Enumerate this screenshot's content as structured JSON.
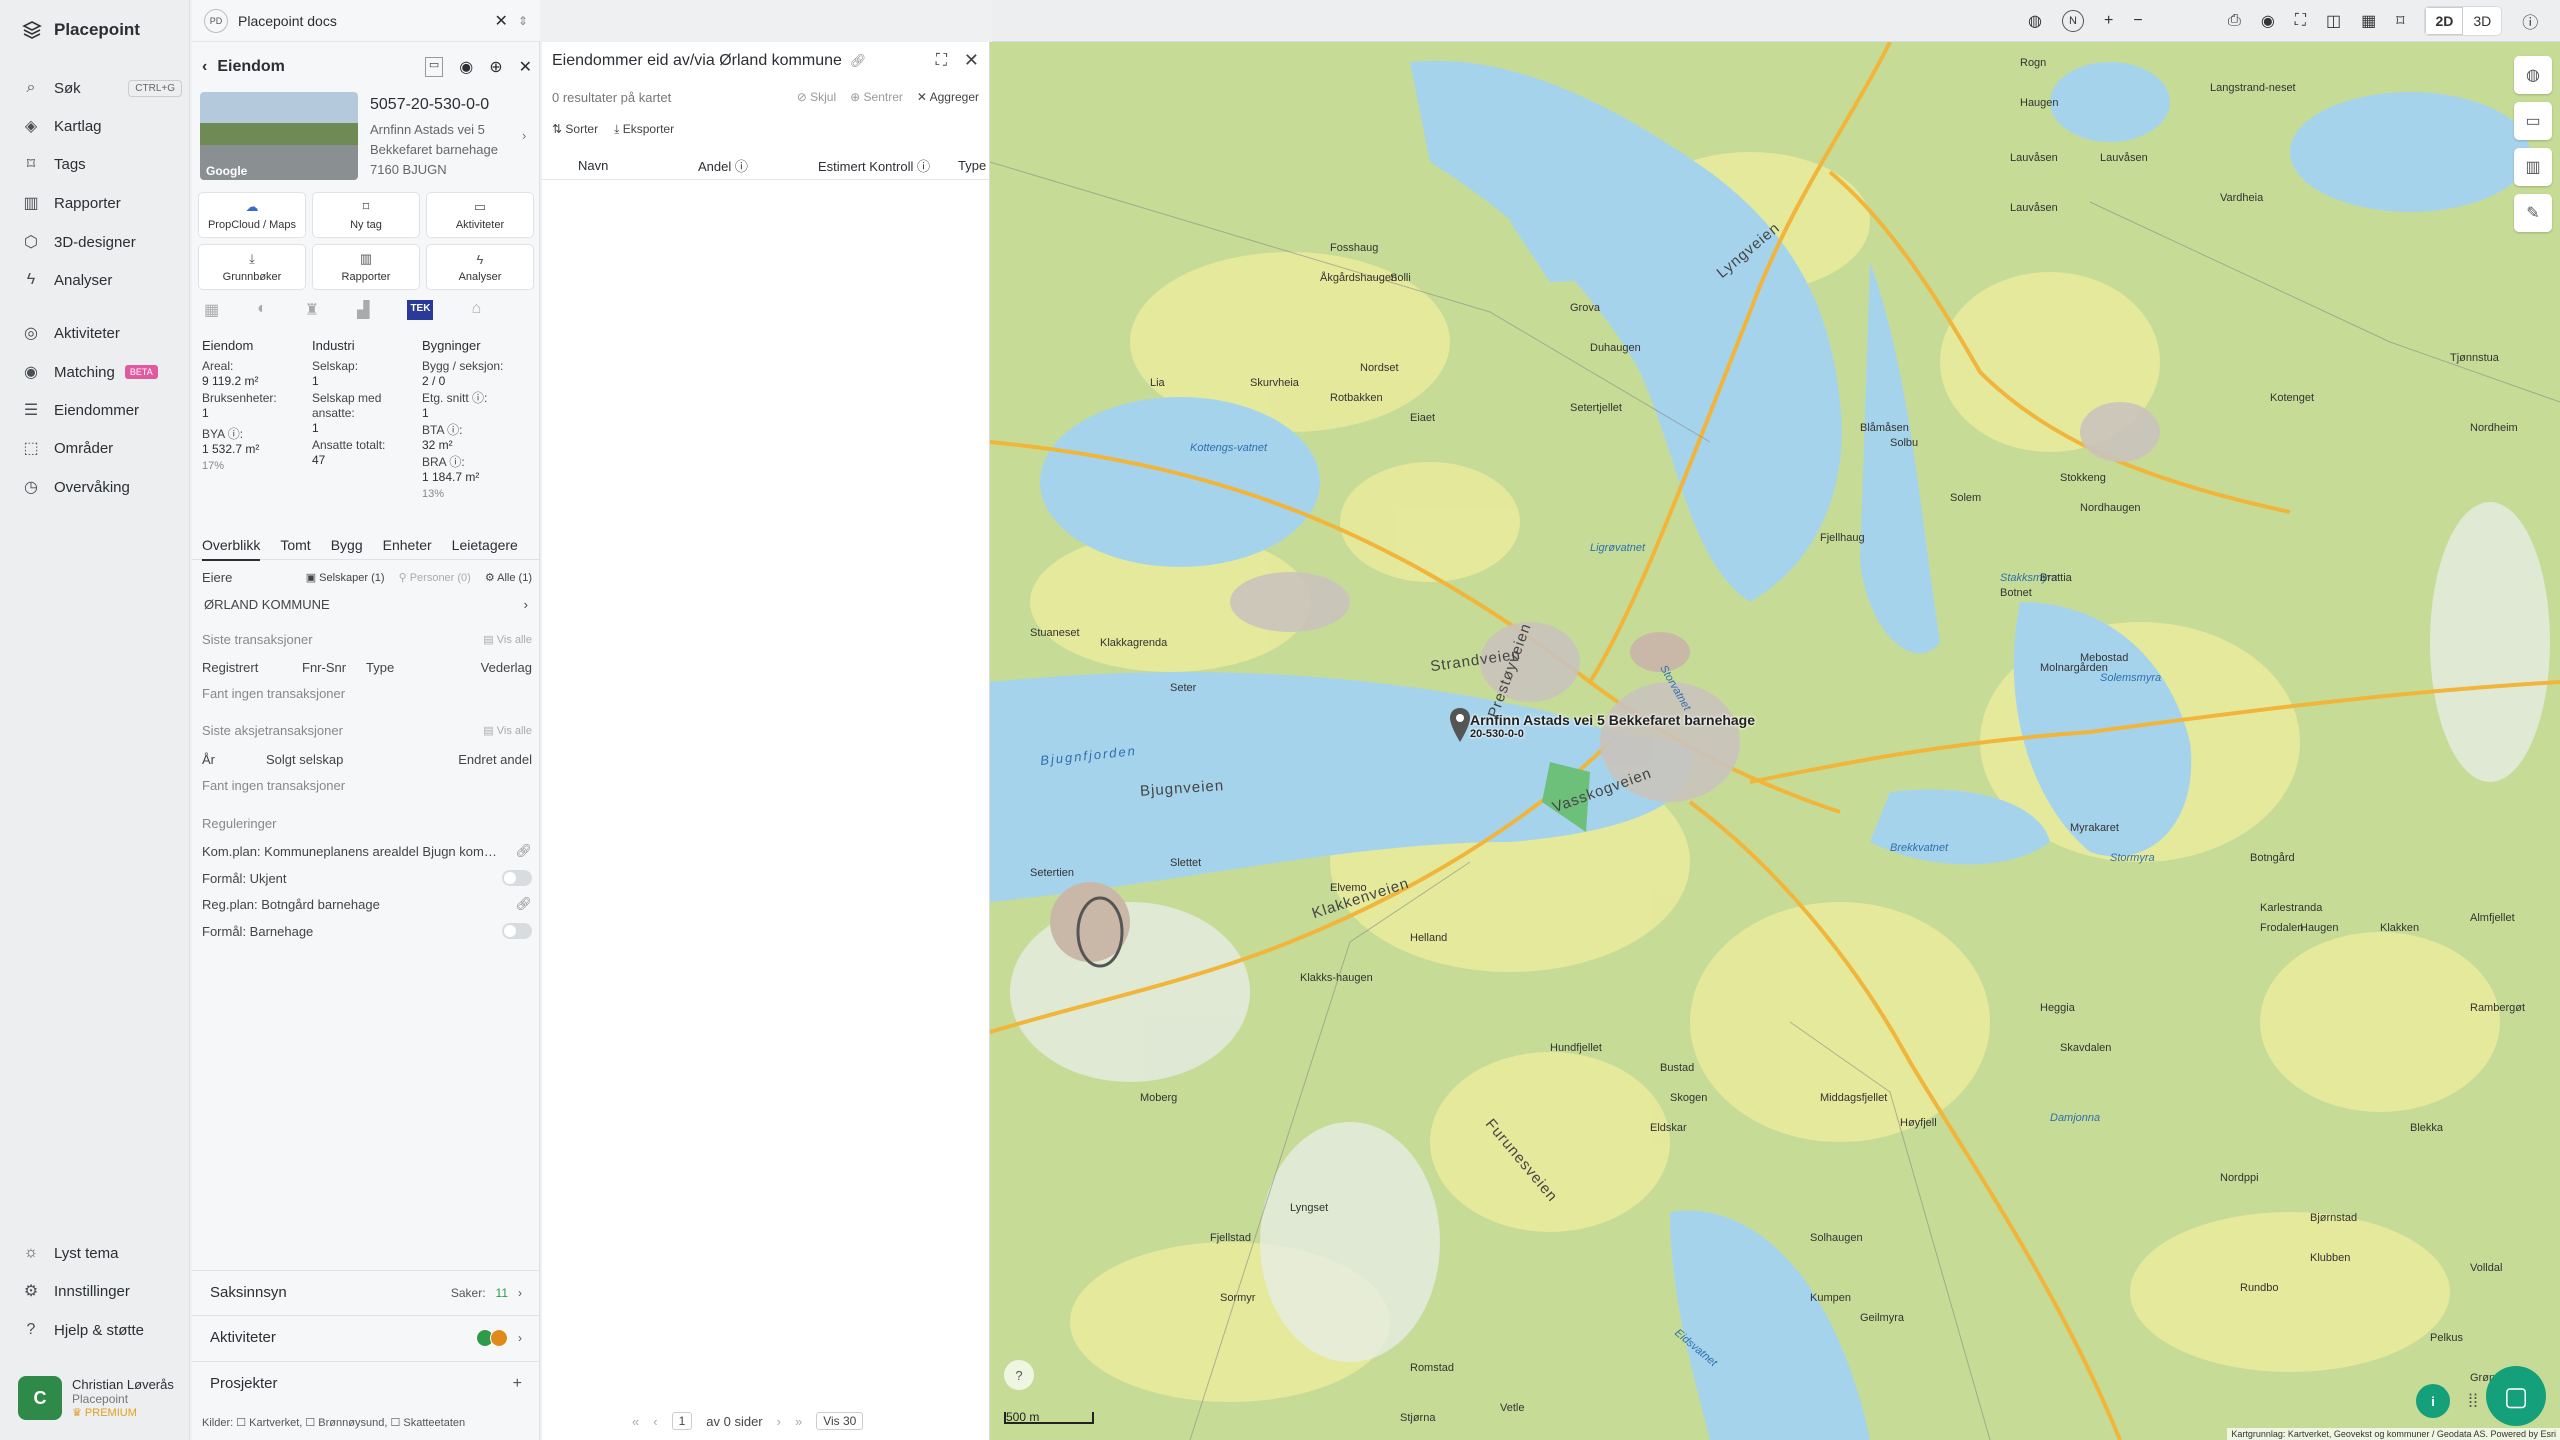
{
  "nav": {
    "brand": "Placepoint",
    "items": [
      {
        "label": "Søk",
        "icon": "search-icon",
        "shortcut": "CTRL+G"
      },
      {
        "label": "Kartlag",
        "icon": "layers-icon"
      },
      {
        "label": "Tags",
        "icon": "bookmark-icon"
      },
      {
        "label": "Rapporter",
        "icon": "chart-icon"
      },
      {
        "label": "3D-designer",
        "icon": "cube-icon"
      },
      {
        "label": "Analyser",
        "icon": "bolt-icon"
      },
      {
        "label": "Aktiviteter",
        "icon": "activity-icon"
      },
      {
        "label": "Matching",
        "icon": "target-icon",
        "badge": "BETA"
      },
      {
        "label": "Eiendommer",
        "icon": "list-icon"
      },
      {
        "label": "Områder",
        "icon": "area-icon"
      },
      {
        "label": "Overvåking",
        "icon": "clock-icon"
      }
    ],
    "bottom": [
      {
        "label": "Lyst tema",
        "icon": "sun-icon"
      },
      {
        "label": "Innstillinger",
        "icon": "gear-icon"
      },
      {
        "label": "Hjelp & støtte",
        "icon": "help-icon"
      }
    ],
    "user": {
      "initial": "C",
      "name": "Christian Løverås",
      "org": "Placepoint",
      "plan": "PREMIUM"
    }
  },
  "prop": {
    "doc_badge": "PD",
    "doc_title": "Placepoint docs",
    "title": "Eiendom",
    "icon_badge": "TEK",
    "thumb_label": "Google",
    "id": "5057-20-530-0-0",
    "addr": [
      "Arnfinn Astads vei 5",
      "Bekkefaret barnehage",
      "7160 BJUGN"
    ],
    "actions": [
      "PropCloud / Maps",
      "Ny tag",
      "Aktiviteter",
      "Grunnbøker",
      "Rapporter",
      "Analyser"
    ],
    "stats": {
      "eiendom": {
        "h": "Eiendom",
        "areal_l": "Areal:",
        "areal": "9 119.2 m²",
        "bruks_l": "Bruksenheter:",
        "bruks": "1",
        "bya_l": "BYA ⓘ:",
        "bya": "1 532.7 m²",
        "bya_pct": "17%"
      },
      "industri": {
        "h": "Industri",
        "selskap_l": "Selskap:",
        "selskap": "1",
        "ansatte_l": "Selskap med ansatte:",
        "ansatte": "1",
        "tot_l": "Ansatte totalt:",
        "tot": "47"
      },
      "bygninger": {
        "h": "Bygninger",
        "bygg_l": "Bygg / seksjon:",
        "bygg": "2 / 0",
        "etg_l": "Etg. snitt ⓘ:",
        "etg": "1",
        "bta_l": "BTA ⓘ:",
        "bta": "32 m²",
        "bra_l": "BRA ⓘ:",
        "bra": "1 184.7 m²",
        "bra_pct": "13%"
      }
    },
    "tabs": [
      "Overblikk",
      "Tomt",
      "Bygg",
      "Enheter",
      "Leietagere"
    ],
    "eiere": {
      "label": "Eiere",
      "selskaper": "Selskaper (1)",
      "personer": "Personer (0)",
      "alle": "Alle (1)",
      "owner": "ØRLAND KOMMUNE"
    },
    "trans": {
      "label": "Siste transaksjoner",
      "vis_alle": "Vis alle",
      "cols": [
        "Registrert",
        "Fnr-Snr",
        "Type",
        "Vederlag"
      ],
      "empty": "Fant ingen transaksjoner"
    },
    "aksje": {
      "label": "Siste aksjetransaksjoner",
      "vis_alle": "Vis alle",
      "cols": [
        "År",
        "Solgt selskap",
        "Endret andel"
      ],
      "empty": "Fant ingen transaksjoner"
    },
    "reg": {
      "label": "Reguleringer",
      "items": [
        "Kom.plan: Kommuneplanens arealdel Bjugn kom…",
        "Formål: Ukjent",
        "Reg.plan: Botngård barnehage",
        "Formål: Barnehage"
      ]
    },
    "accordions": {
      "saksinnsyn": "Saksinnsyn",
      "saker_l": "Saker:",
      "saker": "11",
      "aktiviteter": "Aktiviteter",
      "prosjekter": "Prosjekter"
    },
    "kilder": "Kilder: ☐ Kartverket, ☐ Brønnøysund, ☐ Skatteetaten"
  },
  "list": {
    "title": "Eiendommer eid av/via Ørland kommune",
    "results": "0 resultater på kartet",
    "tools": [
      "Skjul",
      "Sentrer",
      "Aggreger"
    ],
    "sort": "Sorter",
    "export": "Eksporter",
    "cols": [
      "Navn",
      "Andel ⓘ",
      "Estimert Kontroll ⓘ",
      "Type"
    ],
    "pager": {
      "page": "1",
      "of": "av 0 sider",
      "per": "Vis 30"
    }
  },
  "top": {
    "mode2d": "2D",
    "mode3d": "3D"
  },
  "map": {
    "marker": "Arnfinn Astads vei 5 Bekkefaret barnehage",
    "marker_id": "20-530-0-0",
    "scale": "500 m",
    "attribution": "Kartgrunnlag: Kartverket, Geovekst og kommuner / Geodata AS. Powered by Esri",
    "places": [
      "Rogn",
      "Haugen",
      "Langstrand-neset",
      "Lauvåsen",
      "Lauvåsen",
      "Vardheia",
      "Lauvåsen",
      "Fosshaug",
      "Åkgårdshaugen",
      "Solli",
      "Grova",
      "Duhaugen",
      "Tjønnstua",
      "Kotenget",
      "Nordheim",
      "Skurvheia",
      "Lia",
      "Nordset",
      "Rotbakken",
      "Eiaet",
      "Setertjellet",
      "Blåmåsen",
      "Solbu",
      "Solem",
      "Stokkeng",
      "Nordhaugen",
      "Fjellhaug",
      "Brattia",
      "Botnet",
      "Mebostad",
      "Molnargården",
      "Myrakaret",
      "Karlestranda",
      "Botngård",
      "Haugen",
      "Blekka",
      "Rambergøt",
      "Stuaneset",
      "Klakkagrenda",
      "Seter",
      "Setertien",
      "Slettet",
      "Elvemo",
      "Helland",
      "Frodalen",
      "Klakken",
      "Almfjellet",
      "Heggia",
      "Moberg",
      "Klakks-haugen",
      "Hundfjellet",
      "Bustad",
      "Skogen",
      "Eldskar",
      "Middagsfjellet",
      "Høyfjell",
      "Skavdalen",
      "Solhaugen",
      "Kumpen",
      "Geilmyra",
      "Nordppi",
      "Bjørnstad",
      "Lyngset",
      "Fjellstad",
      "Sormyr",
      "Volldal",
      "Klubben",
      "Rundbo",
      "Pelkus",
      "Grønsberg",
      "Romstad",
      "Stjørna",
      "Vetle"
    ],
    "roads": [
      "Strandveien",
      "Bjugnveien",
      "Vasskogveien",
      "Klakkenveien",
      "Furunesveien",
      "Prestøyveien",
      "Lyngveien"
    ],
    "waters": [
      "Kottengs-vatnet",
      "Bjugnfjorden",
      "Storvatnet",
      "Brekkvatnet",
      "Ligrøvatnet",
      "Stakksmyra",
      "Solemsmyra",
      "Stormyra",
      "Damjonna",
      "Eidsvatnet"
    ]
  }
}
